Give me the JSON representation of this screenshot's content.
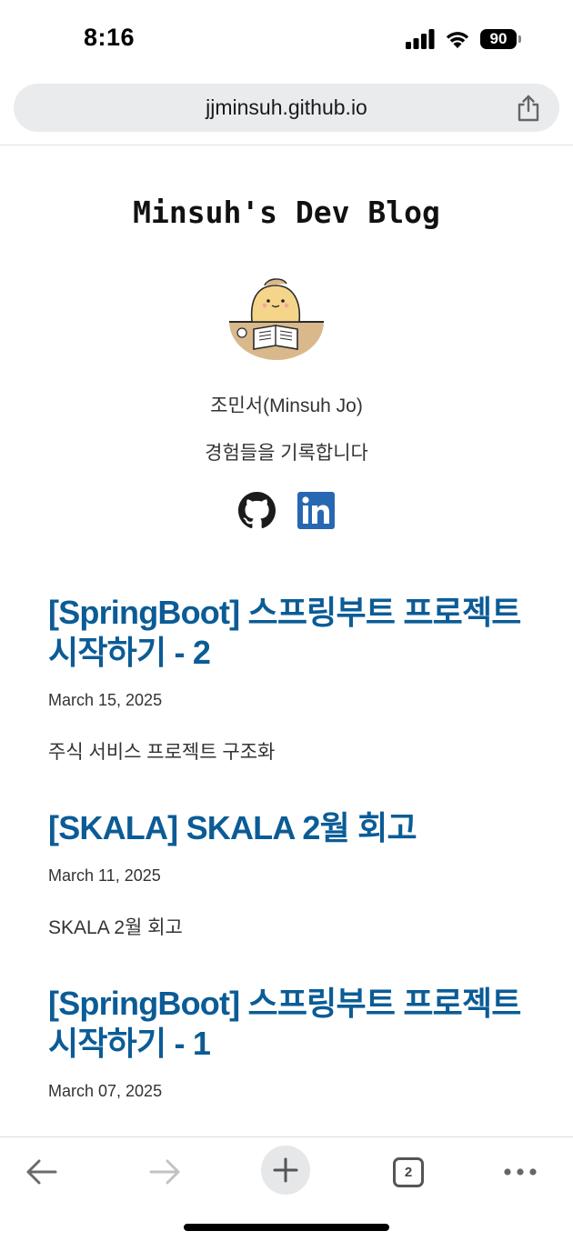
{
  "status_bar": {
    "time": "8:16",
    "battery": "90"
  },
  "browser": {
    "url": "jjminsuh.github.io",
    "tab_count": "2"
  },
  "site": {
    "title": "Minsuh's Dev Blog",
    "author_name": "조민서(Minsuh Jo)",
    "author_bio": "경험들을 기록합니다",
    "social": [
      {
        "icon": "github-icon"
      },
      {
        "icon": "linkedin-icon"
      }
    ]
  },
  "posts": [
    {
      "title": "[SpringBoot] 스프링부트 프로젝트 시작하기 - 2",
      "date": "March 15, 2025",
      "excerpt": "주식 서비스 프로젝트 구조화"
    },
    {
      "title": "[SKALA] SKALA 2월 회고",
      "date": "March 11, 2025",
      "excerpt": "SKALA 2월 회고"
    },
    {
      "title": "[SpringBoot] 스프링부트 프로젝트 시작하기 - 1",
      "date": "March 07, 2025",
      "excerpt": ""
    }
  ],
  "colors": {
    "post_title": "#0b5c96",
    "linkedin": "#2867b2"
  }
}
